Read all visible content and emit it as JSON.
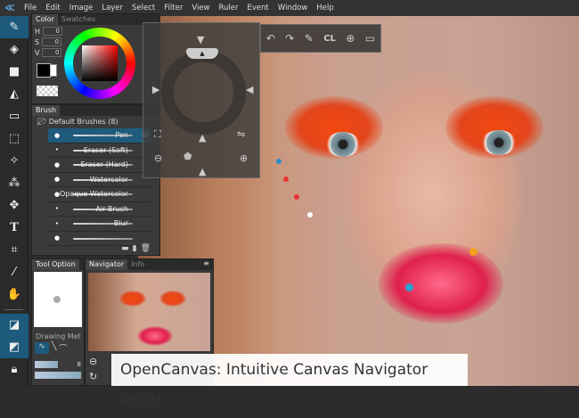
{
  "menu": {
    "logo": "≪",
    "items": [
      "File",
      "Edit",
      "Image",
      "Layer",
      "Select",
      "Filter",
      "View",
      "Ruler",
      "Event",
      "Window",
      "Help"
    ]
  },
  "tools": [
    "pen-icon",
    "eraser-icon",
    "rectangle-icon",
    "fill-icon",
    "gradient-icon",
    "selection-icon",
    "magic-wand-icon",
    "spray-icon",
    "move-icon",
    "text-icon",
    "crop-icon",
    "eyedropper-icon",
    "hand-icon",
    "layer-mode-1-icon",
    "layer-mode-2-icon",
    "lock-icon"
  ],
  "color_panel": {
    "tabs": [
      "Color",
      "Swatches"
    ],
    "h_label": "H",
    "h": "0",
    "s_label": "S",
    "s": "0",
    "v_label": "V",
    "v": "0",
    "primary": "#000000",
    "secondary": "#ffffff"
  },
  "brush_panel": {
    "title": "Brush",
    "folder": "Default Brushes (8)",
    "items": [
      "Pen",
      "Eraser (Soft)",
      "Eraser (Hard)",
      "Watercolor",
      "Opaque Watercolor",
      "Air Brush",
      "Blur",
      ""
    ],
    "selected": 0
  },
  "tool_option": {
    "tab": "Tool Option",
    "drawing_method": "Drawing Met",
    "size_value": "8"
  },
  "navigator": {
    "tabs": [
      "Navigator",
      "Info"
    ]
  },
  "floating_toolbar": {
    "icons": [
      "undo-icon",
      "redo-icon",
      "pen-icon",
      "clear-icon",
      "target-icon",
      "window-icon"
    ],
    "clear_label": "CL"
  },
  "caption": "OpenCanvas: Intuitive Canvas Navigator Panel"
}
